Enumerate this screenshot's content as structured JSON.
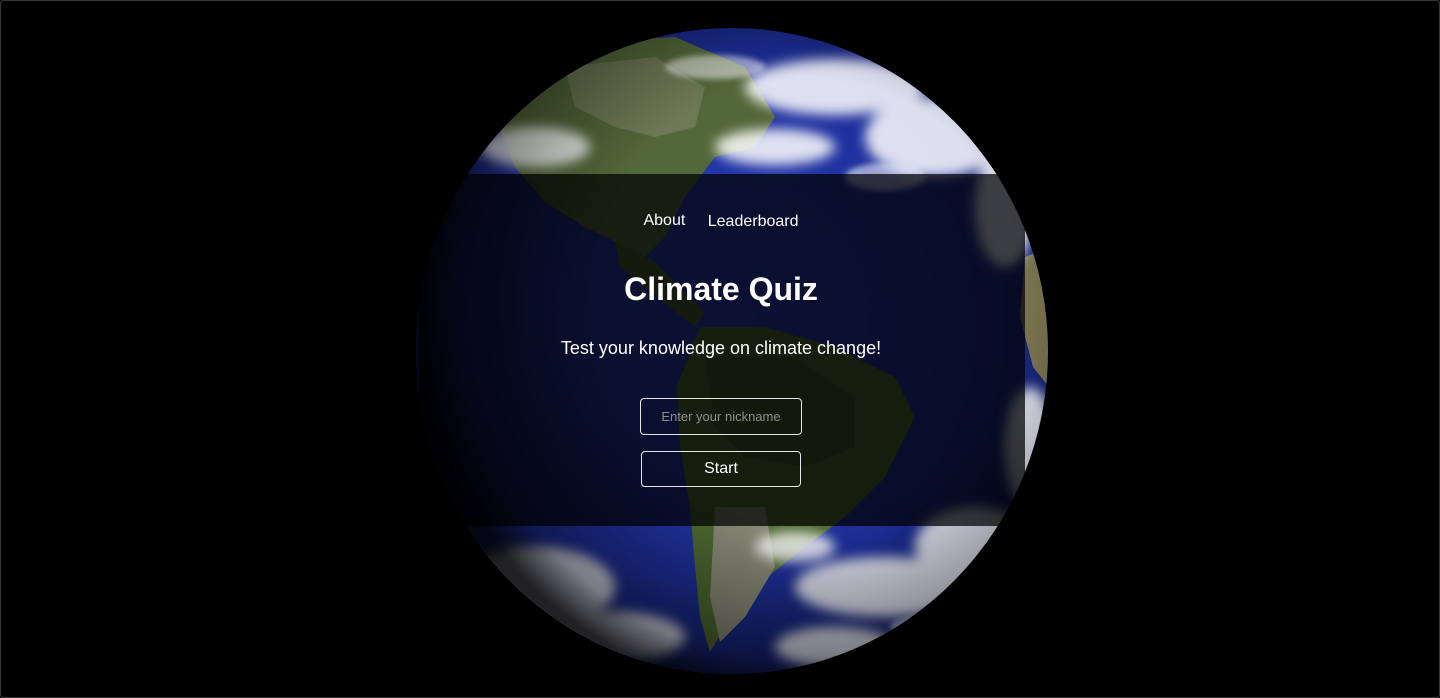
{
  "nav": {
    "about_label": "About",
    "leaderboard_label": "Leaderboard"
  },
  "hero": {
    "title": "Climate Quiz",
    "subtitle": "Test your knowledge on climate change!"
  },
  "form": {
    "nickname_placeholder": "Enter your nickname",
    "nickname_value": "",
    "start_label": "Start"
  },
  "background": {
    "image": "earth-globe"
  },
  "colors": {
    "page_background": "#000000",
    "text": "#ffffff",
    "ocean": "#1c2f9e",
    "land": "#4f6a33"
  }
}
